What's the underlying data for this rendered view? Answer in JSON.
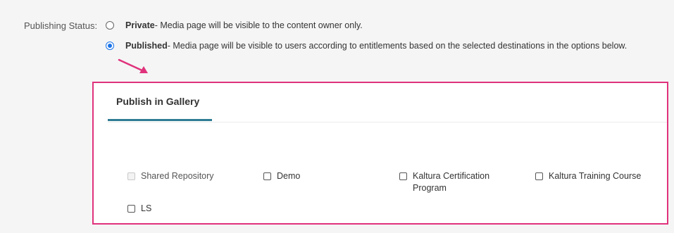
{
  "publishing_status": {
    "label": "Publishing Status:",
    "options": [
      {
        "title": "Private",
        "description": " - Media page will be visible to the content owner only.",
        "checked": false
      },
      {
        "title": "Published",
        "description": " - Media page will be visible to users according to entitlements based on the selected destinations in the options below.",
        "checked": true
      }
    ]
  },
  "gallery_panel": {
    "tab_label": "Publish in Gallery",
    "tab_color": "#2e7d95",
    "highlight_color": "#e0327c",
    "categories": [
      {
        "label": "Shared Repository",
        "checked": false,
        "disabled": true
      },
      {
        "label": "Demo",
        "checked": false,
        "disabled": false
      },
      {
        "label": "Kaltura Certification",
        "label_line2": "Program",
        "checked": false,
        "disabled": false
      },
      {
        "label": "Kaltura Training Course",
        "checked": false,
        "disabled": false
      },
      {
        "label": "LS",
        "checked": false,
        "disabled": false
      }
    ]
  }
}
